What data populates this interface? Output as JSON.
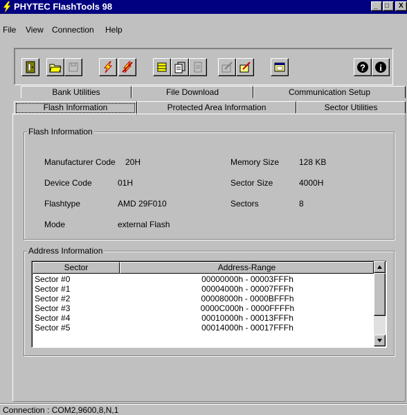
{
  "window": {
    "title": "PHYTEC FlashTools 98",
    "controls": {
      "minimize": "_",
      "maximize": "□",
      "close": "X"
    }
  },
  "menu": {
    "items": [
      {
        "label": "File",
        "accel": "F"
      },
      {
        "label": "View",
        "accel": "V"
      },
      {
        "label": "Connection",
        "accel": "C"
      },
      {
        "label": "Help",
        "accel": "H"
      }
    ]
  },
  "toolbar": {
    "buttons": [
      {
        "icon": "exit-door-icon",
        "enabled": true
      },
      {
        "icon": "open-folder-icon",
        "enabled": true
      },
      {
        "icon": "save-disk-icon",
        "enabled": false
      },
      {
        "icon": "flash-program-icon",
        "enabled": true
      },
      {
        "icon": "flash-erase-icon",
        "enabled": true
      },
      {
        "icon": "chip-icon",
        "enabled": true
      },
      {
        "icon": "copy-pages-icon",
        "enabled": true
      },
      {
        "icon": "blank-page-icon",
        "enabled": false
      },
      {
        "icon": "pen-disabled-icon",
        "enabled": false
      },
      {
        "icon": "pen-edit-icon",
        "enabled": true
      },
      {
        "icon": "window-icon",
        "enabled": true
      },
      {
        "icon": "help-question-icon",
        "enabled": true
      },
      {
        "icon": "info-icon",
        "enabled": true
      }
    ]
  },
  "tabs": {
    "row_back": [
      "Bank Utilities",
      "File Download",
      "Communication Setup"
    ],
    "row_front": [
      "Flash Information",
      "Protected Area Information",
      "Sector Utilities"
    ],
    "active": "Flash Information"
  },
  "flash_info": {
    "legend": "Flash Information",
    "fields_left": [
      {
        "label": "Manufacturer Code",
        "value": "20H"
      },
      {
        "label": "Device Code",
        "value": "01H"
      },
      {
        "label": "Flashtype",
        "value": "AMD 29F010"
      },
      {
        "label": "Mode",
        "value": "external Flash"
      }
    ],
    "fields_right": [
      {
        "label": "Memory Size",
        "value": "128 KB"
      },
      {
        "label": "Sector Size",
        "value": "4000H"
      },
      {
        "label": "Sectors",
        "value": "8"
      }
    ]
  },
  "address_info": {
    "legend": "Address Information",
    "columns": [
      "Sector",
      "Address-Range"
    ],
    "rows": [
      [
        "Sector #0",
        "00000000h - 00003FFFh"
      ],
      [
        "Sector #1",
        "00004000h - 00007FFFh"
      ],
      [
        "Sector #2",
        "00008000h - 0000BFFFh"
      ],
      [
        "Sector #3",
        "0000C000h - 0000FFFFh"
      ],
      [
        "Sector #4",
        "00010000h - 00013FFFh"
      ],
      [
        "Sector #5",
        "00014000h - 00017FFFh"
      ]
    ]
  },
  "status": {
    "text": "Connection : COM2,9600,8,N,1"
  },
  "colors": {
    "title_bg": "#000080",
    "face": "#c0c0c0",
    "list_bg": "#ffffff",
    "accent_red": "#c00000",
    "accent_yellow": "#ffff00"
  }
}
